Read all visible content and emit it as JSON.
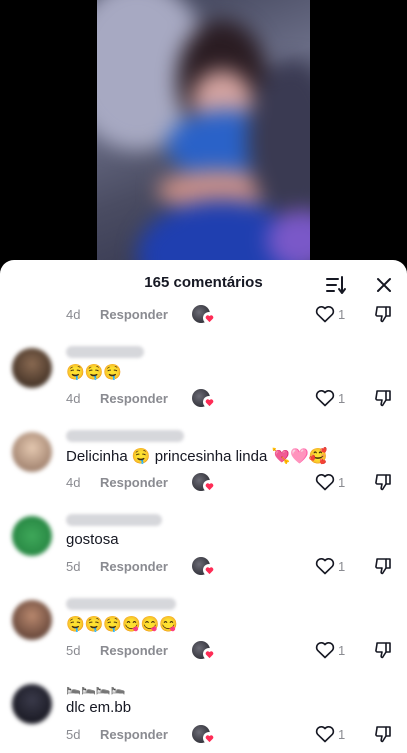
{
  "header": {
    "title": "165 comentários"
  },
  "icons": {
    "sort": "sort-icon",
    "close": "close-icon",
    "like": "heart-outline-icon",
    "dislike": "thumbs-down-icon",
    "creator_heart": "creator-liked-heart-icon"
  },
  "colors": {
    "text_primary": "#161823",
    "text_secondary": "#8a8b91",
    "creator_heart": "#fe2c55",
    "sheet_bg": "#ffffff"
  },
  "reply_label": "Responder",
  "first_meta": {
    "time": "4d",
    "likes": "1"
  },
  "comments": [
    {
      "time": "4d",
      "text": "🤤🤤🤤",
      "likes": "1"
    },
    {
      "time": "4d",
      "text": "Delicinha 🤤 princesinha linda 💘🩷🥰",
      "likes": "1"
    },
    {
      "time": "5d",
      "text": "gostosa",
      "likes": "1"
    },
    {
      "time": "5d",
      "text": "🤤🤤🤤😋😋😋",
      "likes": "1"
    },
    {
      "time": "5d",
      "text": "dlc em.bb",
      "likes": "1"
    }
  ],
  "blurred_username_6": "🛌🛌🛌🛌"
}
